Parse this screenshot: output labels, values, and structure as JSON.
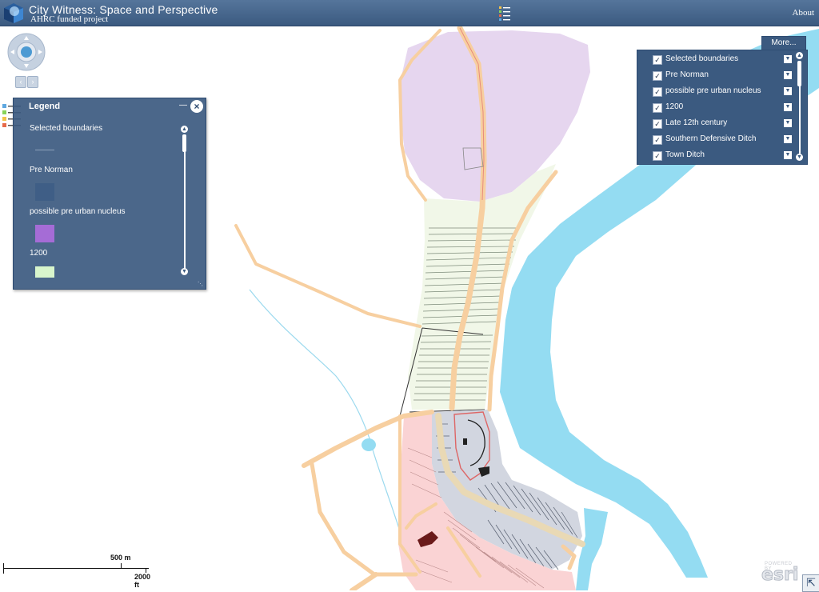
{
  "header": {
    "title": "City Witness: Space and Perspective",
    "subtitle": "AHRC funded project",
    "about_label": "About"
  },
  "legend": {
    "title": "Legend",
    "items": [
      {
        "label": "Selected boundaries",
        "color": "#b9c4d4"
      },
      {
        "label": "Pre Norman",
        "color": "#3f5e86"
      },
      {
        "label": "possible pre urban nucleus",
        "color": "#a56cd6"
      },
      {
        "label": "1200",
        "color": "#d8f5cc"
      }
    ]
  },
  "layers": {
    "more_label": "More...",
    "items": [
      {
        "name": "Selected boundaries",
        "checked": true
      },
      {
        "name": "Pre Norman",
        "checked": true
      },
      {
        "name": "possible pre urban nucleus",
        "checked": true
      },
      {
        "name": "1200",
        "checked": true
      },
      {
        "name": "Late 12th century",
        "checked": true
      },
      {
        "name": "Southern Defensive Ditch",
        "checked": true
      },
      {
        "name": "Town Ditch",
        "checked": true
      }
    ]
  },
  "scale": {
    "metric": "500 m",
    "imperial": "2000 ft"
  },
  "esri": {
    "powered_by": "POWERED BY",
    "brand": "esri"
  },
  "colors": {
    "header": "#3b5a80",
    "river": "#94dcf2",
    "road": "#f7cfa0",
    "pre_urban_nucleus": "#e6d6ef",
    "zone_1200": "#f1f7e8",
    "castle_area": "#d2d6e0",
    "southern_area": "#fad3d4"
  }
}
